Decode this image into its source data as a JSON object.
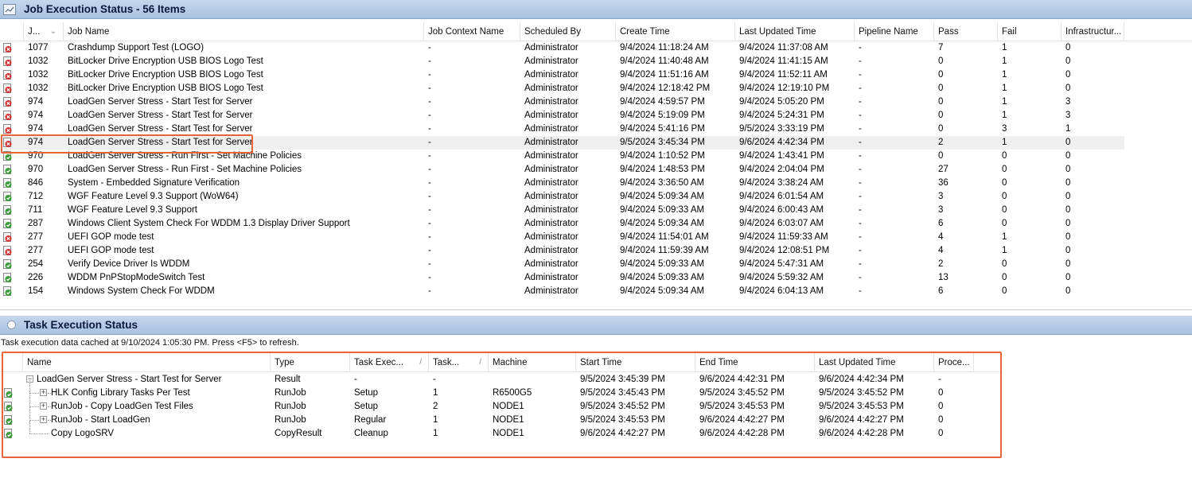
{
  "job_panel": {
    "title": "Job Execution Status - 56 Items",
    "columns": [
      "J...",
      "Job Name",
      "Job Context Name",
      "Scheduled By",
      "Create Time",
      "Last Updated Time",
      "Pipeline Name",
      "Pass",
      "Fail",
      "Infrastructur..."
    ],
    "rows": [
      {
        "status": "fail",
        "id": "1077",
        "name": "Crashdump Support Test (LOGO)",
        "context": "-",
        "scheduled_by": "Administrator",
        "create": "9/4/2024 11:18:24 AM",
        "updated": "9/4/2024 11:37:08 AM",
        "pipeline": "-",
        "pass": "7",
        "fail": "1",
        "infra": "0"
      },
      {
        "status": "fail",
        "id": "1032",
        "name": "BitLocker Drive Encryption USB BIOS Logo Test",
        "context": "-",
        "scheduled_by": "Administrator",
        "create": "9/4/2024 11:40:48 AM",
        "updated": "9/4/2024 11:41:15 AM",
        "pipeline": "-",
        "pass": "0",
        "fail": "1",
        "infra": "0"
      },
      {
        "status": "fail",
        "id": "1032",
        "name": "BitLocker Drive Encryption USB BIOS Logo Test",
        "context": "-",
        "scheduled_by": "Administrator",
        "create": "9/4/2024 11:51:16 AM",
        "updated": "9/4/2024 11:52:11 AM",
        "pipeline": "-",
        "pass": "0",
        "fail": "1",
        "infra": "0"
      },
      {
        "status": "fail",
        "id": "1032",
        "name": "BitLocker Drive Encryption USB BIOS Logo Test",
        "context": "-",
        "scheduled_by": "Administrator",
        "create": "9/4/2024 12:18:42 PM",
        "updated": "9/4/2024 12:19:10 PM",
        "pipeline": "-",
        "pass": "0",
        "fail": "1",
        "infra": "0"
      },
      {
        "status": "fail",
        "id": "974",
        "name": "LoadGen Server Stress - Start Test for Server",
        "context": "-",
        "scheduled_by": "Administrator",
        "create": "9/4/2024 4:59:57 PM",
        "updated": "9/4/2024 5:05:20 PM",
        "pipeline": "-",
        "pass": "0",
        "fail": "1",
        "infra": "3"
      },
      {
        "status": "fail",
        "id": "974",
        "name": "LoadGen Server Stress - Start Test for Server",
        "context": "-",
        "scheduled_by": "Administrator",
        "create": "9/4/2024 5:19:09 PM",
        "updated": "9/4/2024 5:24:31 PM",
        "pipeline": "-",
        "pass": "0",
        "fail": "1",
        "infra": "3"
      },
      {
        "status": "fail",
        "id": "974",
        "name": "LoadGen Server Stress - Start Test for Server",
        "context": "-",
        "scheduled_by": "Administrator",
        "create": "9/4/2024 5:41:16 PM",
        "updated": "9/5/2024 3:33:19 PM",
        "pipeline": "-",
        "pass": "0",
        "fail": "3",
        "infra": "1"
      },
      {
        "status": "fail",
        "id": "974",
        "name": "LoadGen Server Stress - Start Test for Server",
        "context": "-",
        "scheduled_by": "Administrator",
        "create": "9/5/2024 3:45:34 PM",
        "updated": "9/6/2024 4:42:34 PM",
        "pipeline": "-",
        "pass": "2",
        "fail": "1",
        "infra": "0",
        "selected": true
      },
      {
        "status": "pass",
        "id": "970",
        "name": "LoadGen Server Stress - Run First - Set Machine Policies",
        "context": "-",
        "scheduled_by": "Administrator",
        "create": "9/4/2024 1:10:52 PM",
        "updated": "9/4/2024 1:43:41 PM",
        "pipeline": "-",
        "pass": "0",
        "fail": "0",
        "infra": "0"
      },
      {
        "status": "pass",
        "id": "970",
        "name": "LoadGen Server Stress - Run First - Set Machine Policies",
        "context": "-",
        "scheduled_by": "Administrator",
        "create": "9/4/2024 1:48:53 PM",
        "updated": "9/4/2024 2:04:04 PM",
        "pipeline": "-",
        "pass": "27",
        "fail": "0",
        "infra": "0"
      },
      {
        "status": "pass",
        "id": "846",
        "name": "System - Embedded Signature Verification",
        "context": "-",
        "scheduled_by": "Administrator",
        "create": "9/4/2024 3:36:50 AM",
        "updated": "9/4/2024 3:38:24 AM",
        "pipeline": "-",
        "pass": "36",
        "fail": "0",
        "infra": "0"
      },
      {
        "status": "pass",
        "id": "712",
        "name": "WGF Feature Level 9.3 Support (WoW64)",
        "context": "-",
        "scheduled_by": "Administrator",
        "create": "9/4/2024 5:09:34 AM",
        "updated": "9/4/2024 6:01:54 AM",
        "pipeline": "-",
        "pass": "3",
        "fail": "0",
        "infra": "0"
      },
      {
        "status": "pass",
        "id": "711",
        "name": "WGF Feature Level 9.3 Support",
        "context": "-",
        "scheduled_by": "Administrator",
        "create": "9/4/2024 5:09:33 AM",
        "updated": "9/4/2024 6:00:43 AM",
        "pipeline": "-",
        "pass": "3",
        "fail": "0",
        "infra": "0"
      },
      {
        "status": "pass",
        "id": "287",
        "name": "Windows Client System Check For WDDM 1.3 Display Driver Support",
        "context": "-",
        "scheduled_by": "Administrator",
        "create": "9/4/2024 5:09:34 AM",
        "updated": "9/4/2024 6:03:07 AM",
        "pipeline": "-",
        "pass": "6",
        "fail": "0",
        "infra": "0"
      },
      {
        "status": "fail",
        "id": "277",
        "name": "UEFI GOP mode test",
        "context": "-",
        "scheduled_by": "Administrator",
        "create": "9/4/2024 11:54:01 AM",
        "updated": "9/4/2024 11:59:33 AM",
        "pipeline": "-",
        "pass": "4",
        "fail": "1",
        "infra": "0"
      },
      {
        "status": "fail",
        "id": "277",
        "name": "UEFI GOP mode test",
        "context": "-",
        "scheduled_by": "Administrator",
        "create": "9/4/2024 11:59:39 AM",
        "updated": "9/4/2024 12:08:51 PM",
        "pipeline": "-",
        "pass": "4",
        "fail": "1",
        "infra": "0"
      },
      {
        "status": "pass",
        "id": "254",
        "name": "Verify Device Driver Is WDDM",
        "context": "-",
        "scheduled_by": "Administrator",
        "create": "9/4/2024 5:09:33 AM",
        "updated": "9/4/2024 5:47:31 AM",
        "pipeline": "-",
        "pass": "2",
        "fail": "0",
        "infra": "0"
      },
      {
        "status": "pass",
        "id": "226",
        "name": "WDDM PnPStopModeSwitch Test",
        "context": "-",
        "scheduled_by": "Administrator",
        "create": "9/4/2024 5:09:33 AM",
        "updated": "9/4/2024 5:59:32 AM",
        "pipeline": "-",
        "pass": "13",
        "fail": "0",
        "infra": "0"
      },
      {
        "status": "pass",
        "id": "154",
        "name": "Windows System Check For WDDM",
        "context": "-",
        "scheduled_by": "Administrator",
        "create": "9/4/2024 5:09:34 AM",
        "updated": "9/4/2024 6:04:13 AM",
        "pipeline": "-",
        "pass": "6",
        "fail": "0",
        "infra": "0"
      }
    ]
  },
  "task_panel": {
    "title": "Task Execution Status",
    "info": "Task execution data cached at 9/10/2024 1:05:30 PM. Press <F5> to refresh.",
    "columns": [
      "Name",
      "Type",
      "Task Exec...",
      "Task...",
      "Machine",
      "Start Time",
      "End Time",
      "Last Updated Time",
      "Proce..."
    ],
    "rows": [
      {
        "level": 0,
        "toggle": "−",
        "status": "",
        "name": "LoadGen Server Stress - Start Test for Server",
        "type": "Result",
        "exec": "-",
        "task": "-",
        "machine": "",
        "start": "9/5/2024 3:45:39 PM",
        "end": "9/6/2024 4:42:31 PM",
        "updated": "9/6/2024 4:42:34 PM",
        "proc": "-"
      },
      {
        "level": 1,
        "toggle": "+",
        "status": "pass",
        "name": "HLK Config Library Tasks Per Test",
        "type": "RunJob",
        "exec": "Setup",
        "task": "1",
        "machine": "R6500G5",
        "start": "9/5/2024 3:45:43 PM",
        "end": "9/5/2024 3:45:52 PM",
        "updated": "9/5/2024 3:45:52 PM",
        "proc": "0"
      },
      {
        "level": 1,
        "toggle": "+",
        "status": "pass",
        "name": "RunJob - Copy LoadGen Test Files",
        "type": "RunJob",
        "exec": "Setup",
        "task": "2",
        "machine": "NODE1",
        "start": "9/5/2024 3:45:52 PM",
        "end": "9/5/2024 3:45:53 PM",
        "updated": "9/5/2024 3:45:53 PM",
        "proc": "0"
      },
      {
        "level": 1,
        "toggle": "+",
        "status": "pass",
        "name": "RunJob - Start LoadGen",
        "type": "RunJob",
        "exec": "Regular",
        "task": "1",
        "machine": "NODE1",
        "start": "9/5/2024 3:45:53 PM",
        "end": "9/6/2024 4:42:27 PM",
        "updated": "9/6/2024 4:42:27 PM",
        "proc": "0"
      },
      {
        "level": 1,
        "toggle": "",
        "status": "pass",
        "name": "Copy LogoSRV",
        "type": "CopyResult",
        "exec": "Cleanup",
        "task": "1",
        "machine": "NODE1",
        "start": "9/6/2024 4:42:27 PM",
        "end": "9/6/2024 4:42:28 PM",
        "updated": "9/6/2024 4:42:28 PM",
        "proc": "0"
      }
    ]
  },
  "colors": {
    "header_bg": "#b4c9e4",
    "highlight": "#e8643a",
    "pass": "#3a9a3a",
    "fail": "#d03030"
  }
}
